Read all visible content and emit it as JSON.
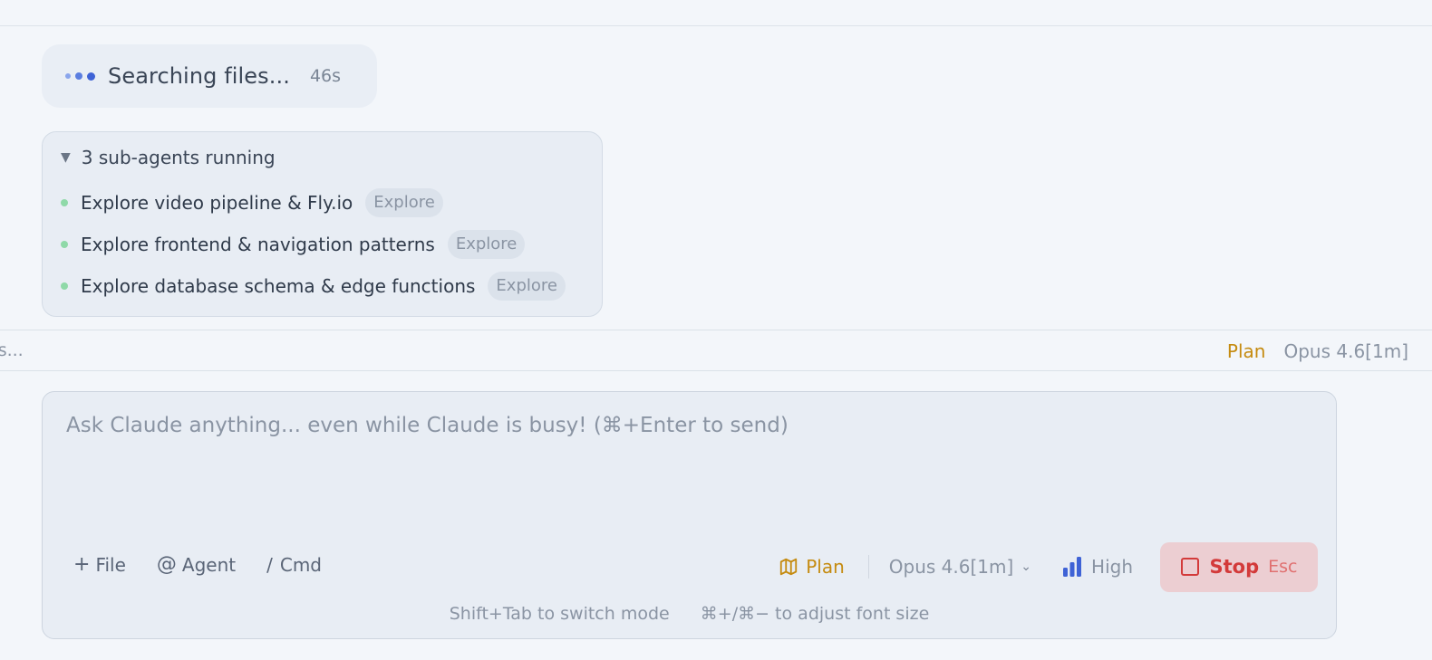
{
  "searching": {
    "text": "Searching files...",
    "elapsed": "46s"
  },
  "subagents": {
    "title": "3 sub-agents running",
    "items": [
      {
        "name": "Explore video pipeline & Fly.io",
        "tag": "Explore",
        "status_color": "#8fd9a8"
      },
      {
        "name": "Explore frontend & navigation patterns",
        "tag": "Explore",
        "status_color": "#8fd9a8"
      },
      {
        "name": "Explore database schema & edge functions",
        "tag": "Explore",
        "status_color": "#8fd9a8"
      }
    ]
  },
  "status_bar": {
    "left_text": "es...",
    "mode": "Plan",
    "model": "Opus 4.6[1m]"
  },
  "composer": {
    "placeholder": "Ask Claude anything... even while Claude is busy! (⌘+Enter to send)",
    "value": "",
    "file_label": "File",
    "agent_label": "Agent",
    "cmd_label": "Cmd",
    "plan_label": "Plan",
    "model_label": "Opus 4.6[1m]",
    "effort_label": "High",
    "stop_label": "Stop",
    "stop_shortcut": "Esc",
    "hint_mode": "Shift+Tab to switch mode",
    "hint_font": "⌘+/⌘− to adjust font size"
  },
  "colors": {
    "accent_blue": "#3f63d6",
    "plan_amber": "#c58b10",
    "stop_red": "#d33a3a",
    "running_green": "#8fd9a8"
  },
  "icons": {
    "file": "plus-icon",
    "agent": "at-icon",
    "cmd": "slash-icon",
    "plan": "map-icon",
    "model": "chevron-down-icon",
    "effort": "signal-bars-icon",
    "stop": "stop-square-icon",
    "subagents_toggle": "triangle-down-icon"
  }
}
